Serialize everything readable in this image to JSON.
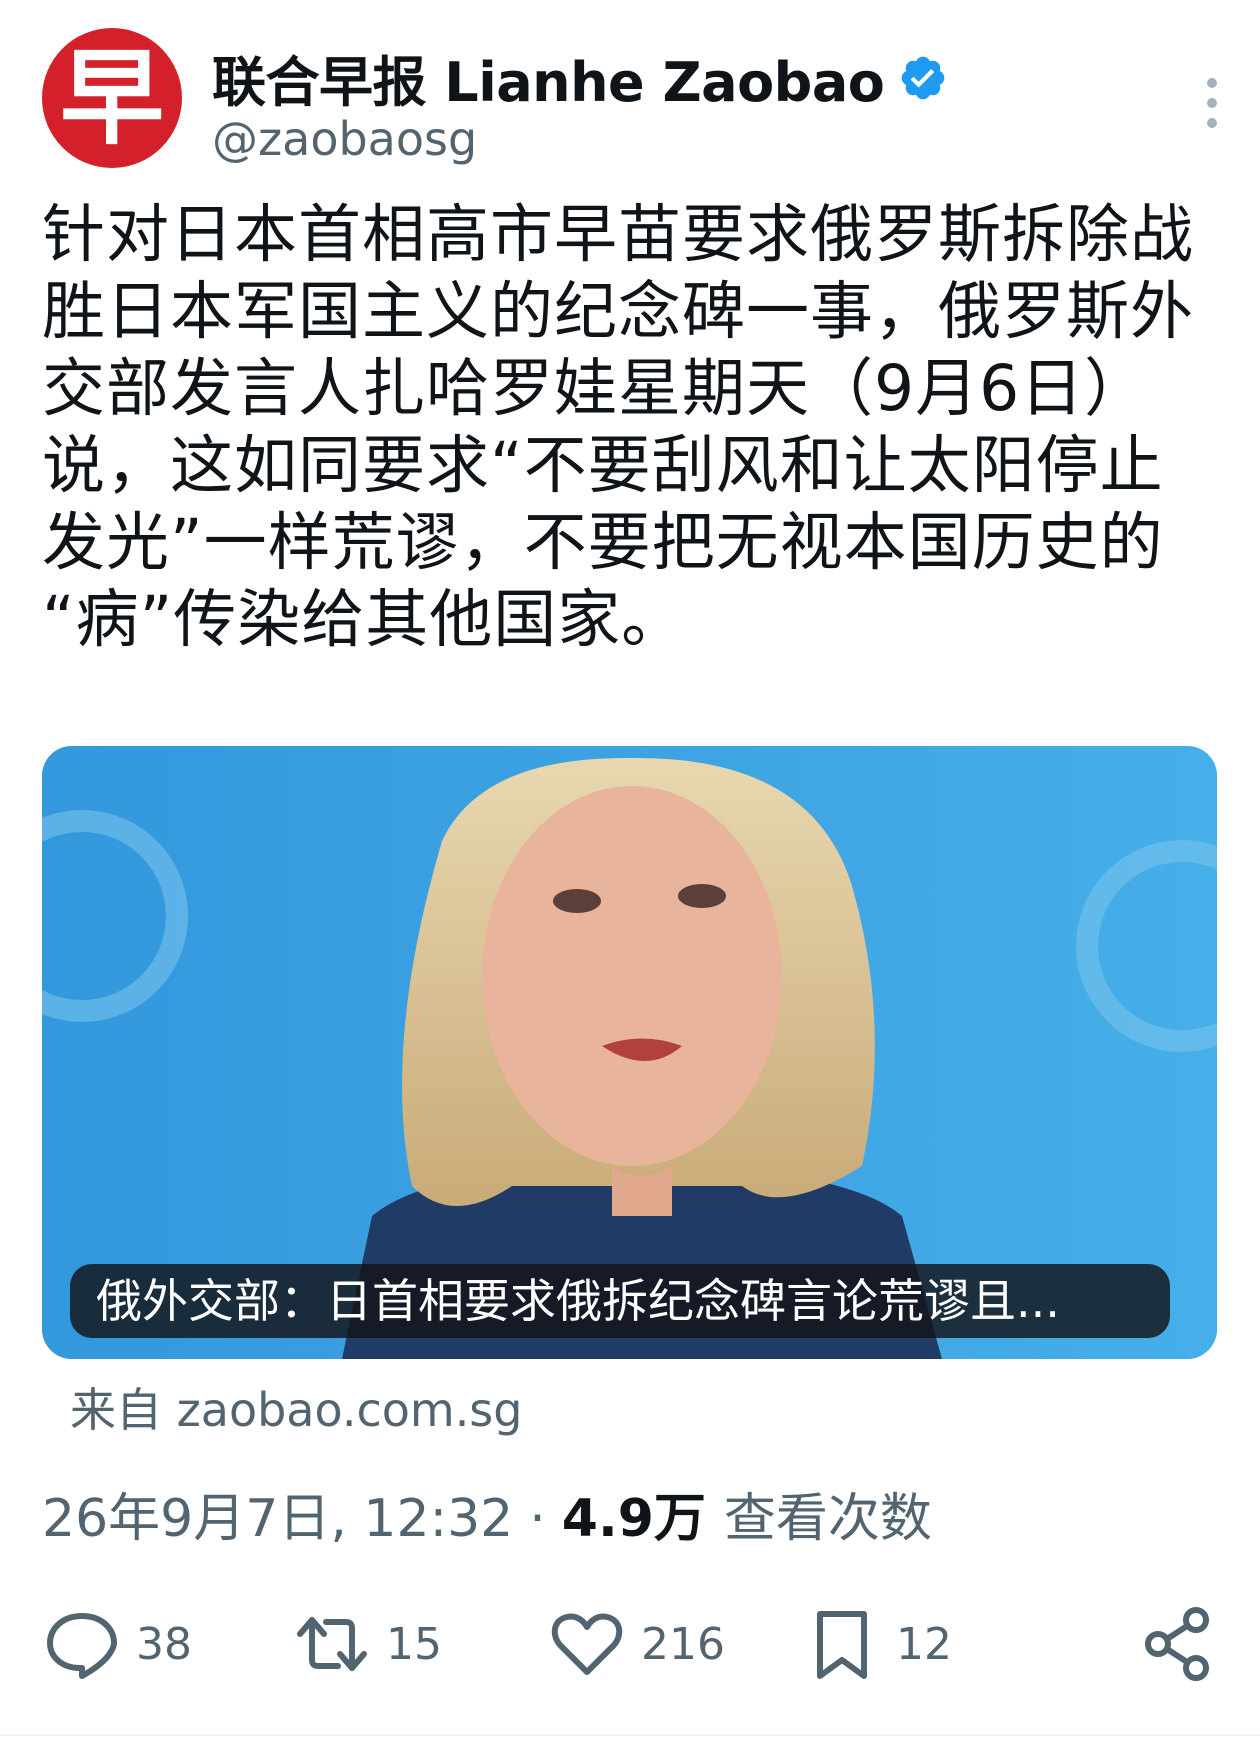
{
  "account": {
    "display_name": "联合早报 Lianhe Zaobao",
    "handle": "@zaobaosg",
    "avatar_char": "早",
    "avatar_color": "#d3202a",
    "verified_color": "#1d9bf0"
  },
  "post": {
    "text": "针对日本首相高市早苗要求俄罗斯拆除战\n胜日本军国主义的纪念碑一事，俄罗斯外\n交部发言人扎哈罗娃星期天（9月6日）\n说，这如同要求“不要刮风和让太阳停止\n发光”一样荒谬，不要把无视本国历史的\n“病”传染给其他国家。"
  },
  "link_card": {
    "caption": "俄外交部：日首相要求俄拆纪念碑言论荒谬且...",
    "source": "来自 zaobao.com.sg"
  },
  "meta": {
    "timestamp": "26年9月7日, 12:32",
    "separator": "·",
    "views_count": "4.9万",
    "views_label": "查看次数"
  },
  "actions": {
    "replies": "38",
    "reposts": "15",
    "likes": "216",
    "bookmarks": "12"
  },
  "icons": [
    "more-icon",
    "verified-icon",
    "reply-icon",
    "repost-icon",
    "like-icon",
    "bookmark-icon",
    "share-icon"
  ]
}
